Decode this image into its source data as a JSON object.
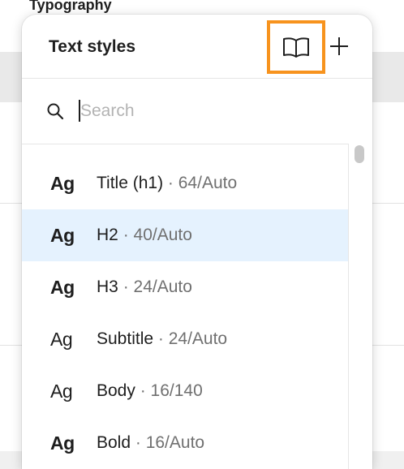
{
  "background": {
    "header_text": "Typography"
  },
  "panel": {
    "title": "Text styles",
    "library_button_icon": "book-open-icon",
    "add_button_icon": "plus-icon",
    "highlight_color": "#f7931e"
  },
  "search": {
    "placeholder": "Search",
    "value": "",
    "icon": "search-icon"
  },
  "styles": [
    {
      "preview": "Ag",
      "name": "Title (h1)",
      "meta": "64/Auto",
      "selected": false
    },
    {
      "preview": "Ag",
      "name": "H2",
      "meta": "40/Auto",
      "selected": true
    },
    {
      "preview": "Ag",
      "name": "H3",
      "meta": "24/Auto",
      "selected": false
    },
    {
      "preview": "Ag",
      "name": "Subtitle",
      "meta": "24/Auto",
      "selected": false
    },
    {
      "preview": "Ag",
      "name": "Body",
      "meta": "16/140",
      "selected": false
    },
    {
      "preview": "Ag",
      "name": "Bold",
      "meta": "16/Auto",
      "selected": false
    }
  ],
  "separator": " · ",
  "colors": {
    "selected_row": "#e5f2fe",
    "text": "#1e1e1e",
    "muted": "#707070"
  }
}
